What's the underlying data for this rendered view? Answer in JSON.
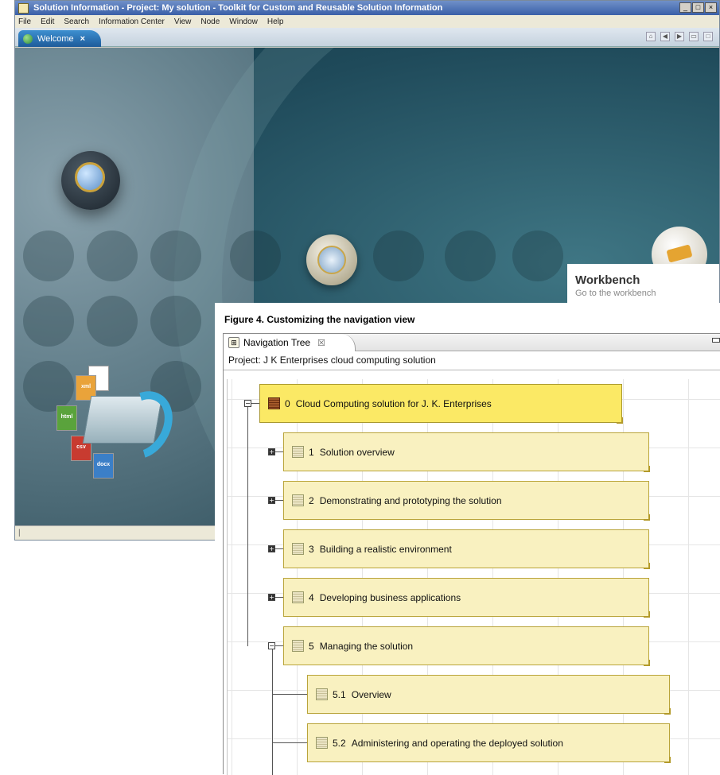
{
  "background_window": {
    "title": "Solution Information - Project: My solution - Toolkit for Custom and Reusable Solution Information",
    "controls": [
      "_",
      "□",
      "×"
    ],
    "menu": [
      "File",
      "Edit",
      "Search",
      "Information Center",
      "View",
      "Node",
      "Window",
      "Help"
    ],
    "tab": {
      "label": "Welcome",
      "close": "×"
    },
    "workbench": {
      "title": "Workbench",
      "subtitle": "Go to the workbench"
    },
    "docs": [
      "xml",
      "html",
      "csv",
      "docx"
    ]
  },
  "figure": {
    "caption": "Figure 4. Customizing the navigation view",
    "view_tab": {
      "label": "Navigation Tree",
      "close": "☒"
    },
    "project_label": "Project: J K Enterprises cloud computing solution",
    "nodes": [
      {
        "num": "0",
        "label": "Cloud Computing solution for J. K. Enterprises",
        "level": 0,
        "toggle": "−",
        "root": true
      },
      {
        "num": "1",
        "label": "Solution overview",
        "level": 1,
        "toggle": "+"
      },
      {
        "num": "2",
        "label": "Demonstrating and prototyping the solution",
        "level": 1,
        "toggle": "+"
      },
      {
        "num": "3",
        "label": "Building a realistic environment",
        "level": 1,
        "toggle": "+"
      },
      {
        "num": "4",
        "label": "Developing business applications",
        "level": 1,
        "toggle": "+"
      },
      {
        "num": "5",
        "label": "Managing the solution",
        "level": 1,
        "toggle": "−"
      },
      {
        "num": "5.1",
        "label": "Overview",
        "level": 2,
        "toggle": ""
      },
      {
        "num": "5.2",
        "label": "Administering and operating the deployed solution",
        "level": 2,
        "toggle": ""
      }
    ]
  }
}
